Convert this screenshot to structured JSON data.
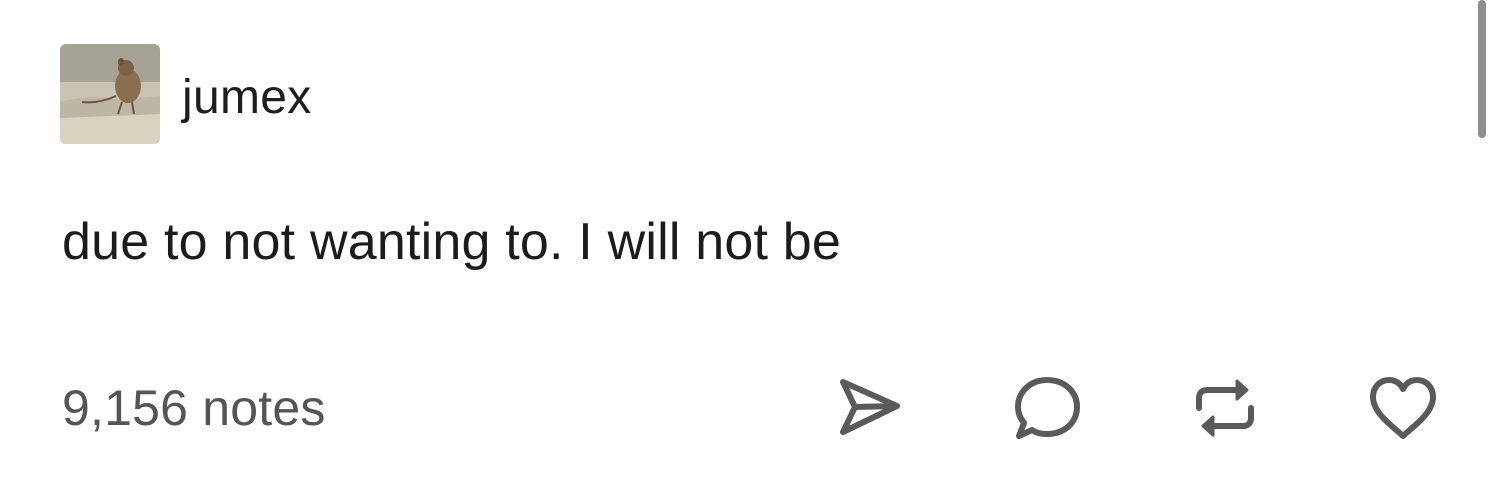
{
  "post": {
    "username": "jumex",
    "body_text": "due to not wanting to. I will not be",
    "notes_count": "9,156 notes",
    "avatar_icon": "gerbil-photo",
    "actions": [
      {
        "name": "share-button",
        "icon": "send-icon"
      },
      {
        "name": "reply-button",
        "icon": "comment-icon"
      },
      {
        "name": "reblog-button",
        "icon": "reblog-icon"
      },
      {
        "name": "like-button",
        "icon": "heart-icon"
      }
    ]
  },
  "colors": {
    "text": "#1c1c1c",
    "muted_text": "#555555",
    "icon": "#5a5a5a",
    "background": "#ffffff",
    "scrollbar": "#8e8e8e"
  }
}
